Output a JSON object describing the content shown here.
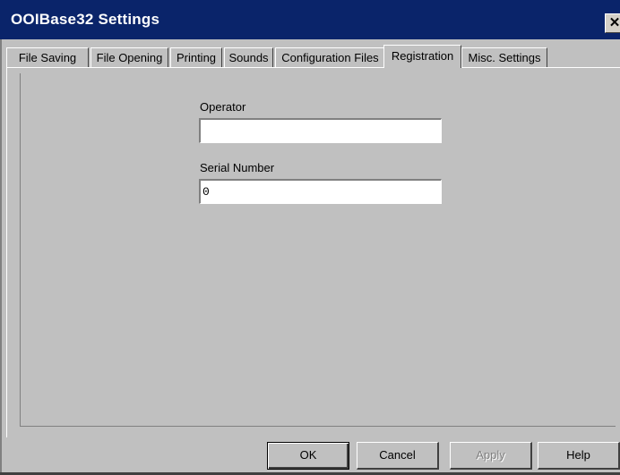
{
  "window": {
    "title": "OOIBase32 Settings",
    "close_glyph": "✕"
  },
  "tabs": [
    {
      "label": "File Saving"
    },
    {
      "label": "File Opening"
    },
    {
      "label": "Printing"
    },
    {
      "label": "Sounds"
    },
    {
      "label": "Configuration Files"
    },
    {
      "label": "Registration",
      "active": true
    },
    {
      "label": "Misc. Settings"
    }
  ],
  "registration": {
    "operator_label": "Operator",
    "operator_value": "",
    "serial_label": "Serial Number",
    "serial_value": "0"
  },
  "buttons": {
    "ok": "OK",
    "cancel": "Cancel",
    "apply": "Apply",
    "help": "Help"
  }
}
